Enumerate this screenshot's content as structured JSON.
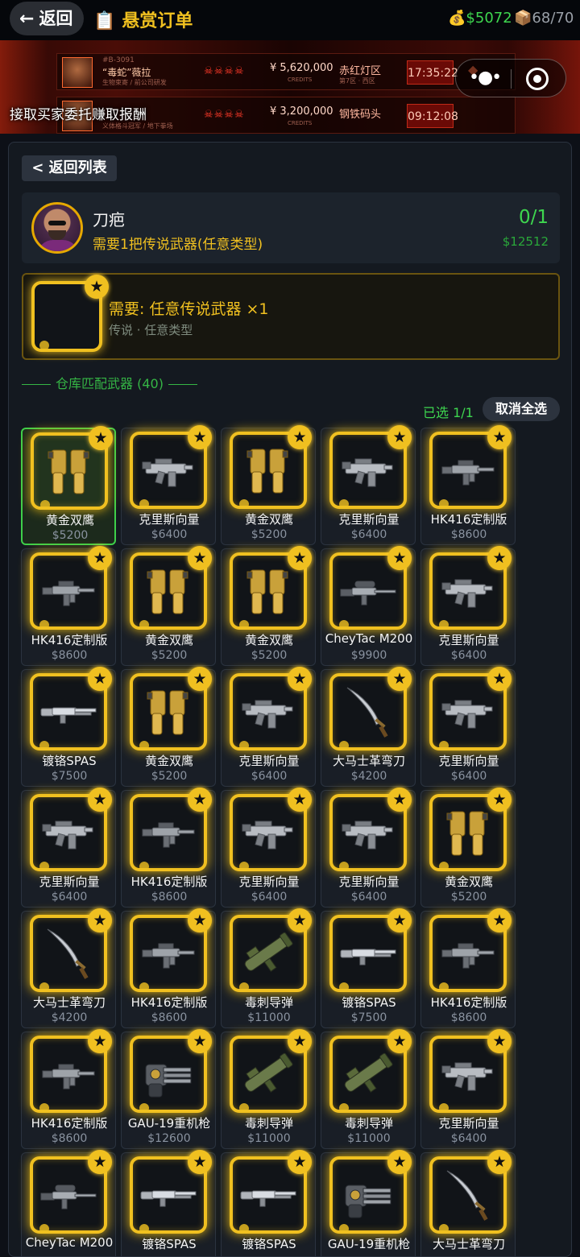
{
  "header": {
    "back_label": "返回",
    "title": "悬赏订单",
    "money": "$5072",
    "cargo": "68/70"
  },
  "banner": {
    "rows": [
      {
        "id": "#B-3091",
        "name": "“毒蛇”薇拉",
        "sub": "生物束寄 / 前公司研发",
        "credits": "¥ 5,620,000",
        "credits_label": "CREDITS",
        "location": "赤红灯区",
        "location_sub": "第7区 · 西区",
        "time": "17:35:22"
      },
      {
        "id": "",
        "name": "",
        "sub": "义体格斗冠军 / 地下拳场",
        "credits": "¥ 3,200,000",
        "credits_label": "CREDITS",
        "location": "钢铁码头",
        "location_sub": "",
        "time": "09:12:08"
      }
    ],
    "caption": "接取买家委托赚取报酬"
  },
  "panel": {
    "back_list_label": "< 返回列表",
    "client": {
      "name": "刀疤",
      "requirement": "需要1把传说武器(任意类型)",
      "progress": "0/1",
      "reward": "$12512"
    },
    "request": {
      "title": "需要: 任意传说武器 ×1",
      "subtitle": "传说 · 任意类型"
    },
    "stock_title": "仓库匹配武器 (40)",
    "selected_count": "已选 1/1",
    "deselect_label": "取消全选"
  },
  "colors": {
    "legendary_gold": "#f0c020",
    "selected_green": "#3ecf4a",
    "money_green": "#3ed64f"
  },
  "weapons": [
    {
      "name": "黄金双鹰",
      "price": "$5200",
      "icon": "pistols",
      "selected": true
    },
    {
      "name": "克里斯向量",
      "price": "$6400",
      "icon": "smg"
    },
    {
      "name": "黄金双鹰",
      "price": "$5200",
      "icon": "pistols"
    },
    {
      "name": "克里斯向量",
      "price": "$6400",
      "icon": "smg"
    },
    {
      "name": "HK416定制版",
      "price": "$8600",
      "icon": "rifle"
    },
    {
      "name": "HK416定制版",
      "price": "$8600",
      "icon": "rifle"
    },
    {
      "name": "黄金双鹰",
      "price": "$5200",
      "icon": "pistols"
    },
    {
      "name": "黄金双鹰",
      "price": "$5200",
      "icon": "pistols"
    },
    {
      "name": "CheyTac M200",
      "price": "$9900",
      "icon": "sniper"
    },
    {
      "name": "克里斯向量",
      "price": "$6400",
      "icon": "smg"
    },
    {
      "name": "镀铬SPAS",
      "price": "$7500",
      "icon": "shotgun"
    },
    {
      "name": "黄金双鹰",
      "price": "$5200",
      "icon": "pistols"
    },
    {
      "name": "克里斯向量",
      "price": "$6400",
      "icon": "smg"
    },
    {
      "name": "大马士革弯刀",
      "price": "$4200",
      "icon": "scimitar"
    },
    {
      "name": "克里斯向量",
      "price": "$6400",
      "icon": "smg"
    },
    {
      "name": "克里斯向量",
      "price": "$6400",
      "icon": "smg"
    },
    {
      "name": "HK416定制版",
      "price": "$8600",
      "icon": "rifle"
    },
    {
      "name": "克里斯向量",
      "price": "$6400",
      "icon": "smg"
    },
    {
      "name": "克里斯向量",
      "price": "$6400",
      "icon": "smg"
    },
    {
      "name": "黄金双鹰",
      "price": "$5200",
      "icon": "pistols"
    },
    {
      "name": "大马士革弯刀",
      "price": "$4200",
      "icon": "scimitar"
    },
    {
      "name": "HK416定制版",
      "price": "$8600",
      "icon": "rifle"
    },
    {
      "name": "毒刺导弹",
      "price": "$11000",
      "icon": "launcher"
    },
    {
      "name": "镀铬SPAS",
      "price": "$7500",
      "icon": "shotgun"
    },
    {
      "name": "HK416定制版",
      "price": "$8600",
      "icon": "rifle"
    },
    {
      "name": "HK416定制版",
      "price": "$8600",
      "icon": "rifle"
    },
    {
      "name": "GAU-19重机枪",
      "price": "$12600",
      "icon": "minigun"
    },
    {
      "name": "毒刺导弹",
      "price": "$11000",
      "icon": "launcher"
    },
    {
      "name": "毒刺导弹",
      "price": "$11000",
      "icon": "launcher"
    },
    {
      "name": "克里斯向量",
      "price": "$6400",
      "icon": "smg"
    },
    {
      "name": "CheyTac M200",
      "price": "",
      "icon": "sniper"
    },
    {
      "name": "镀铬SPAS",
      "price": "",
      "icon": "shotgun"
    },
    {
      "name": "镀铬SPAS",
      "price": "",
      "icon": "shotgun"
    },
    {
      "name": "GAU-19重机枪",
      "price": "",
      "icon": "minigun"
    },
    {
      "name": "大马士革弯刀",
      "price": "",
      "icon": "scimitar"
    }
  ]
}
